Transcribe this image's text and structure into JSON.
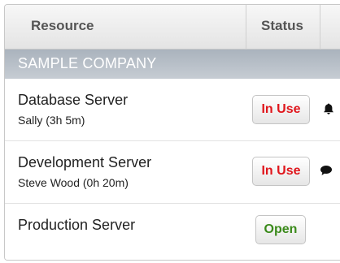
{
  "header": {
    "resource_label": "Resource",
    "status_label": "Status"
  },
  "group": {
    "name": "SAMPLE COMPANY"
  },
  "rows": [
    {
      "name": "Database Server",
      "user": "Sally (3h 5m)",
      "status": "In Use",
      "status_color": "#e0161c",
      "icon": "bell-icon"
    },
    {
      "name": "Development Server",
      "user": "Steve Wood (0h 20m)",
      "status": "In Use",
      "status_color": "#e0161c",
      "icon": "comment-icon"
    },
    {
      "name": "Production Server",
      "status": "Open",
      "status_color": "#3a8a1a"
    }
  ]
}
